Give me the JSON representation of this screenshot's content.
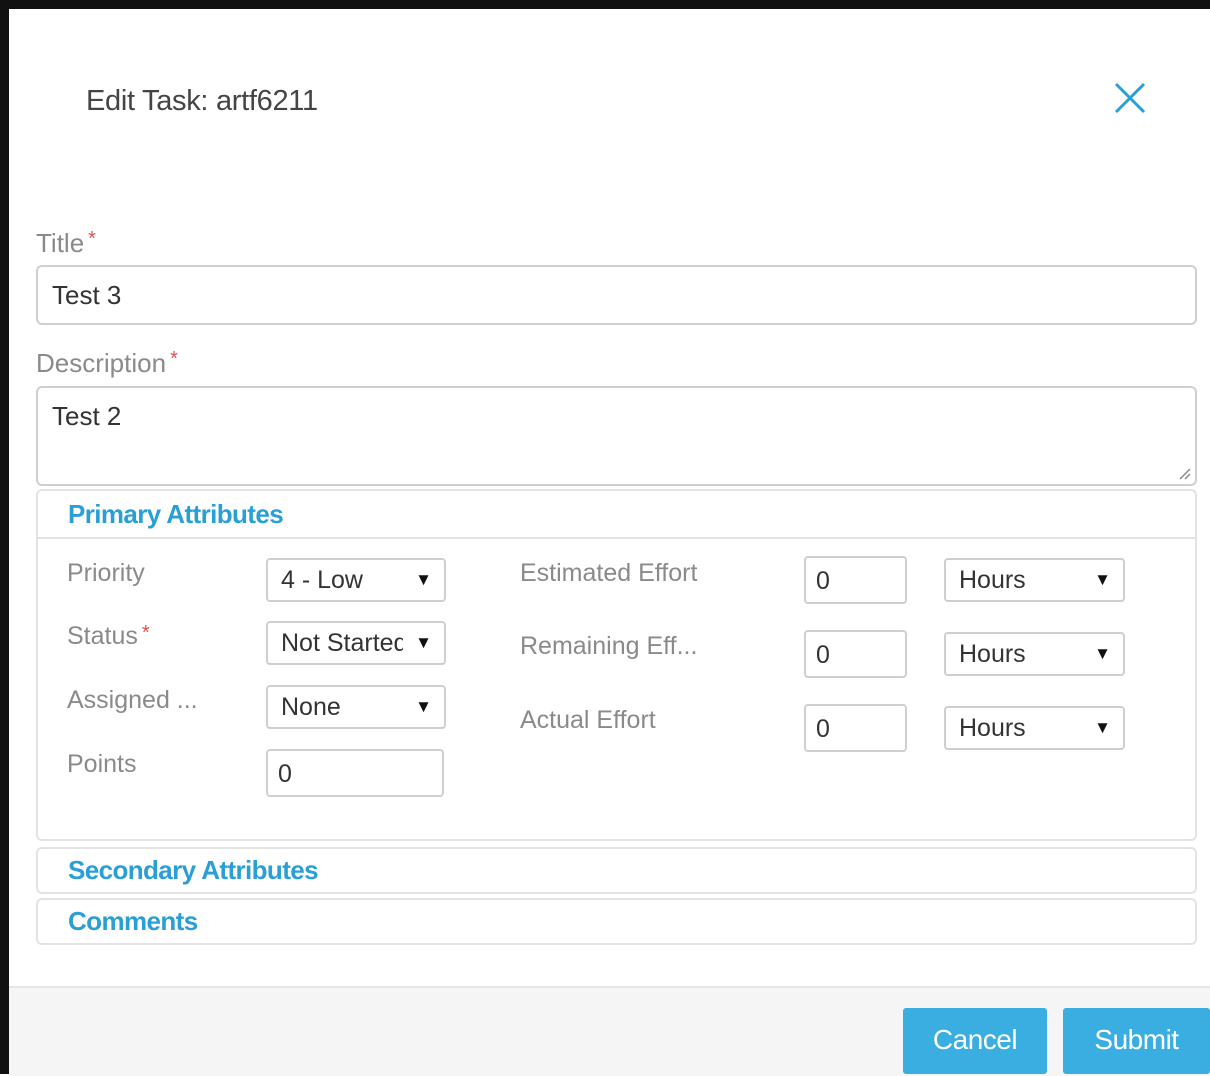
{
  "dialog": {
    "title": "Edit Task: artf6211"
  },
  "form": {
    "title_label": "Title",
    "title_value": "Test 3",
    "description_label": "Description",
    "description_value": "Test 2",
    "required_marker": "*"
  },
  "primary": {
    "header": "Primary Attributes",
    "priority_label": "Priority",
    "priority_value": "4 - Low",
    "status_label": "Status",
    "status_value": "Not Started",
    "assigned_label": "Assigned ...",
    "assigned_value": "None",
    "points_label": "Points",
    "points_value": "0",
    "estimated_label": "Estimated Effort",
    "estimated_value": "0",
    "estimated_unit": "Hours",
    "remaining_label": "Remaining Eff...",
    "remaining_value": "0",
    "remaining_unit": "Hours",
    "actual_label": "Actual Effort",
    "actual_value": "0",
    "actual_unit": "Hours",
    "caret": "▼"
  },
  "secondary": {
    "header": "Secondary Attributes"
  },
  "comments": {
    "header": "Comments"
  },
  "footer": {
    "cancel_label": "Cancel",
    "submit_label": "Submit"
  },
  "icons": {
    "close": "close-icon",
    "resize": "resize-grip-icon",
    "dropdown": "chevron-down-icon"
  },
  "colors": {
    "accent": "#2a9fd6",
    "button": "#3aaee0",
    "required": "#d9534f"
  }
}
